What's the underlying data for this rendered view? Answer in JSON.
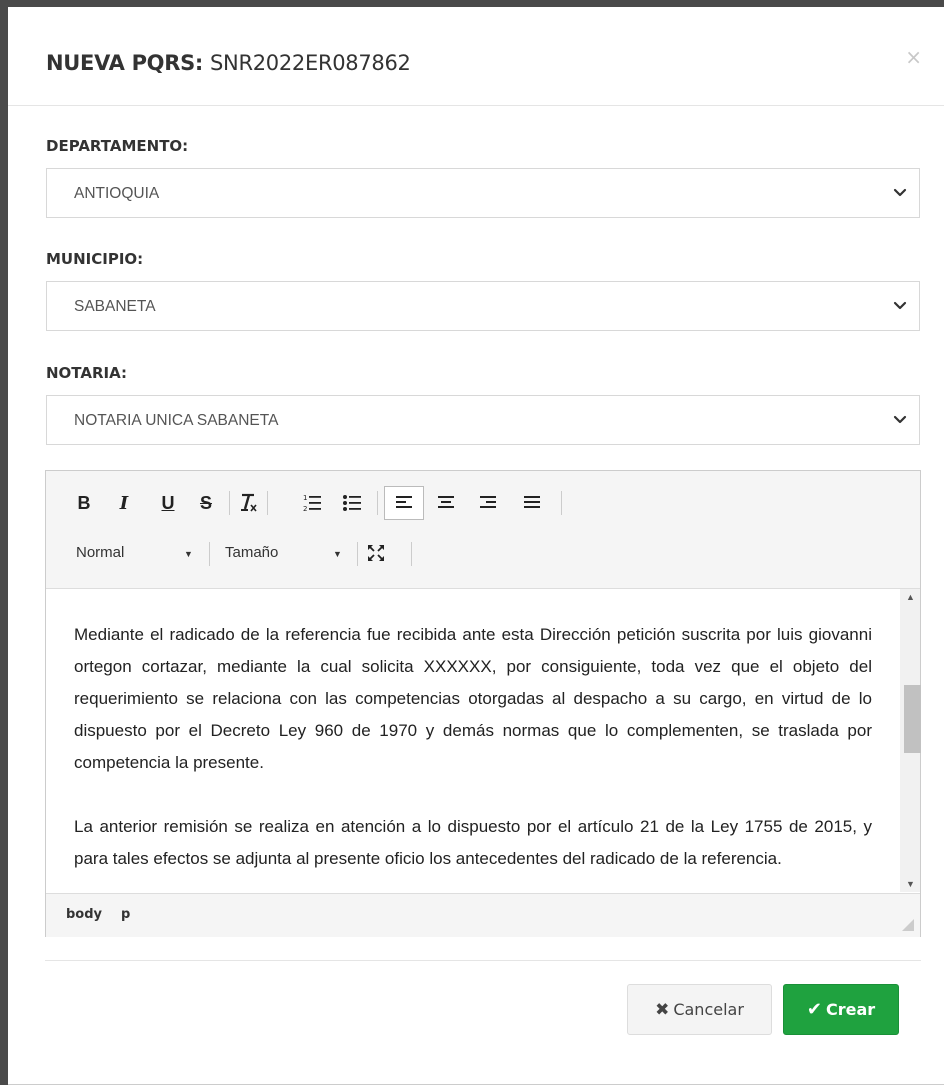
{
  "modal": {
    "title_prefix": "NUEVA PQRS:",
    "title_value": "SNR2022ER087862",
    "close_glyph": "×"
  },
  "fields": {
    "departamento": {
      "label": "DEPARTAMENTO:",
      "value": "ANTIOQUIA"
    },
    "municipio": {
      "label": "MUNICIPIO:",
      "value": "SABANETA"
    },
    "notaria": {
      "label": "NOTARIA:",
      "value": "NOTARIA UNICA SABANETA"
    }
  },
  "editor": {
    "toolbar": {
      "bold": "B",
      "italic": "I",
      "underline": "U",
      "strike": "S",
      "format_select": "Normal",
      "size_select": "Tamaño"
    },
    "paragraphs": [
      "Mediante el radicado de la referencia fue recibida ante esta Dirección petición suscrita por luis giovanni ortegon cortazar, mediante la cual solicita XXXXXX, por consiguiente, toda vez que el objeto del requerimiento se relaciona con las competencias otorgadas al despacho a su cargo, en virtud de lo dispuesto por el Decreto Ley 960 de 1970 y demás normas que lo complementen, se traslada por competencia la presente.",
      "La anterior remisión se realiza en atención a lo dispuesto por el artículo 21 de la Ley 1755 de 2015, y para tales efectos se adjunta al presente oficio los antecedentes del radicado de la referencia."
    ],
    "path": [
      "body",
      "p"
    ]
  },
  "buttons": {
    "cancel": "Cancelar",
    "create": "Crear"
  },
  "colors": {
    "create_green": "#1fa23f",
    "overlay": "#4a4a4a"
  }
}
